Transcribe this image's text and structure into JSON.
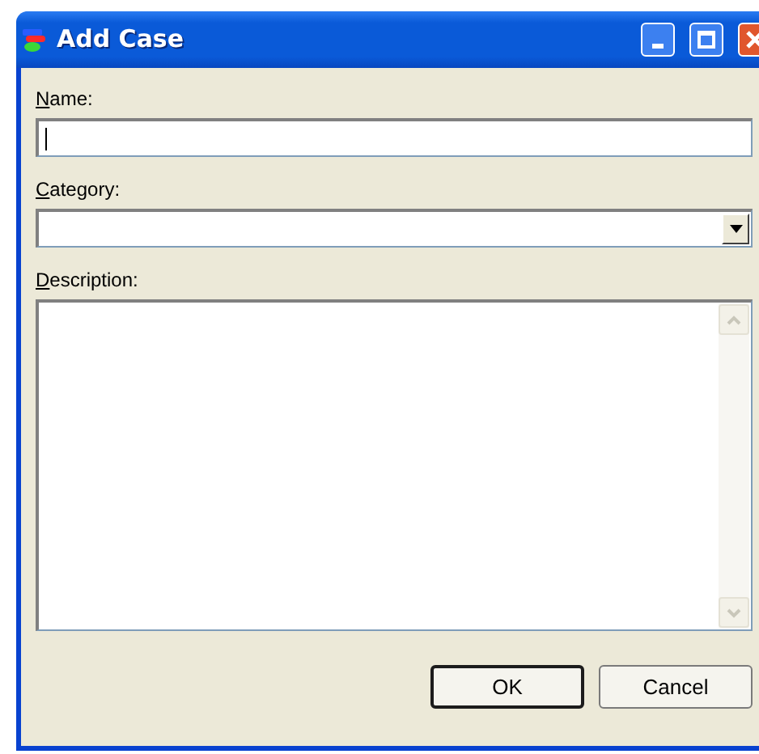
{
  "window": {
    "title": "Add Case",
    "controls": [
      {
        "kind": "minimize"
      },
      {
        "kind": "maximize"
      },
      {
        "kind": "close"
      }
    ]
  },
  "fields": [
    {
      "kind": "text",
      "label": "Name:",
      "underline_first": true,
      "focused": true
    },
    {
      "kind": "combo",
      "label": "Category:",
      "underline_first": true,
      "focused": false
    },
    {
      "kind": "memo",
      "label": "Description:",
      "underline_first": true,
      "focused": false
    }
  ],
  "buttons": [
    {
      "label": "OK",
      "default": true
    },
    {
      "label": "Cancel",
      "default": false
    }
  ]
}
